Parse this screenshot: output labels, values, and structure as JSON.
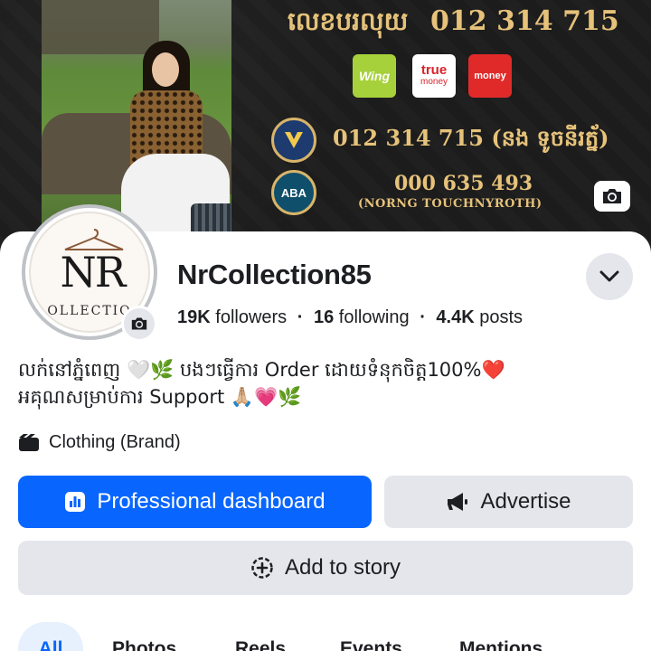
{
  "cover": {
    "account_label": "លេខបរលុយ",
    "account_number": "012 314 715",
    "payment_wing": "Wing",
    "payment_true_top": "true",
    "payment_true_bottom": "money",
    "payment_third": "money",
    "bank_line_1": "012 314 715 (នង ទូចនីរត្ន័)",
    "bank_aba_label": "ABA",
    "bank_line_2": "000 635 493",
    "bank_line_2_name": "(NORNG TOUCHNYROTH)"
  },
  "profile": {
    "logo_main": "NR",
    "logo_sub": "OLLECTIO",
    "page_name": "NrCollection85",
    "followers_count": "19K",
    "followers_label": "followers",
    "following_count": "16",
    "following_label": "following",
    "posts_count": "4.4K",
    "posts_label": "posts",
    "separator": "·",
    "bio_line_1": "លក់នៅភ្នំពេញ 🤍🌿 បងៗធ្វើការ Order ដោយទំនុកចិត្ត100%❤️",
    "bio_line_2": "អគុណសម្រាប់ការ Support 🙏🏼💗🌿",
    "category": "Clothing (Brand)"
  },
  "actions": {
    "professional_dashboard": "Professional dashboard",
    "advertise": "Advertise",
    "add_to_story": "Add to story"
  },
  "tabs": [
    "All",
    "Photos",
    "Reels",
    "Events",
    "Mentions"
  ],
  "colors": {
    "primary": "#0866ff",
    "secondary_button": "#e4e6eb",
    "active_tab_bg": "#e7f0fd",
    "cover_gold": "#e6c27a"
  }
}
